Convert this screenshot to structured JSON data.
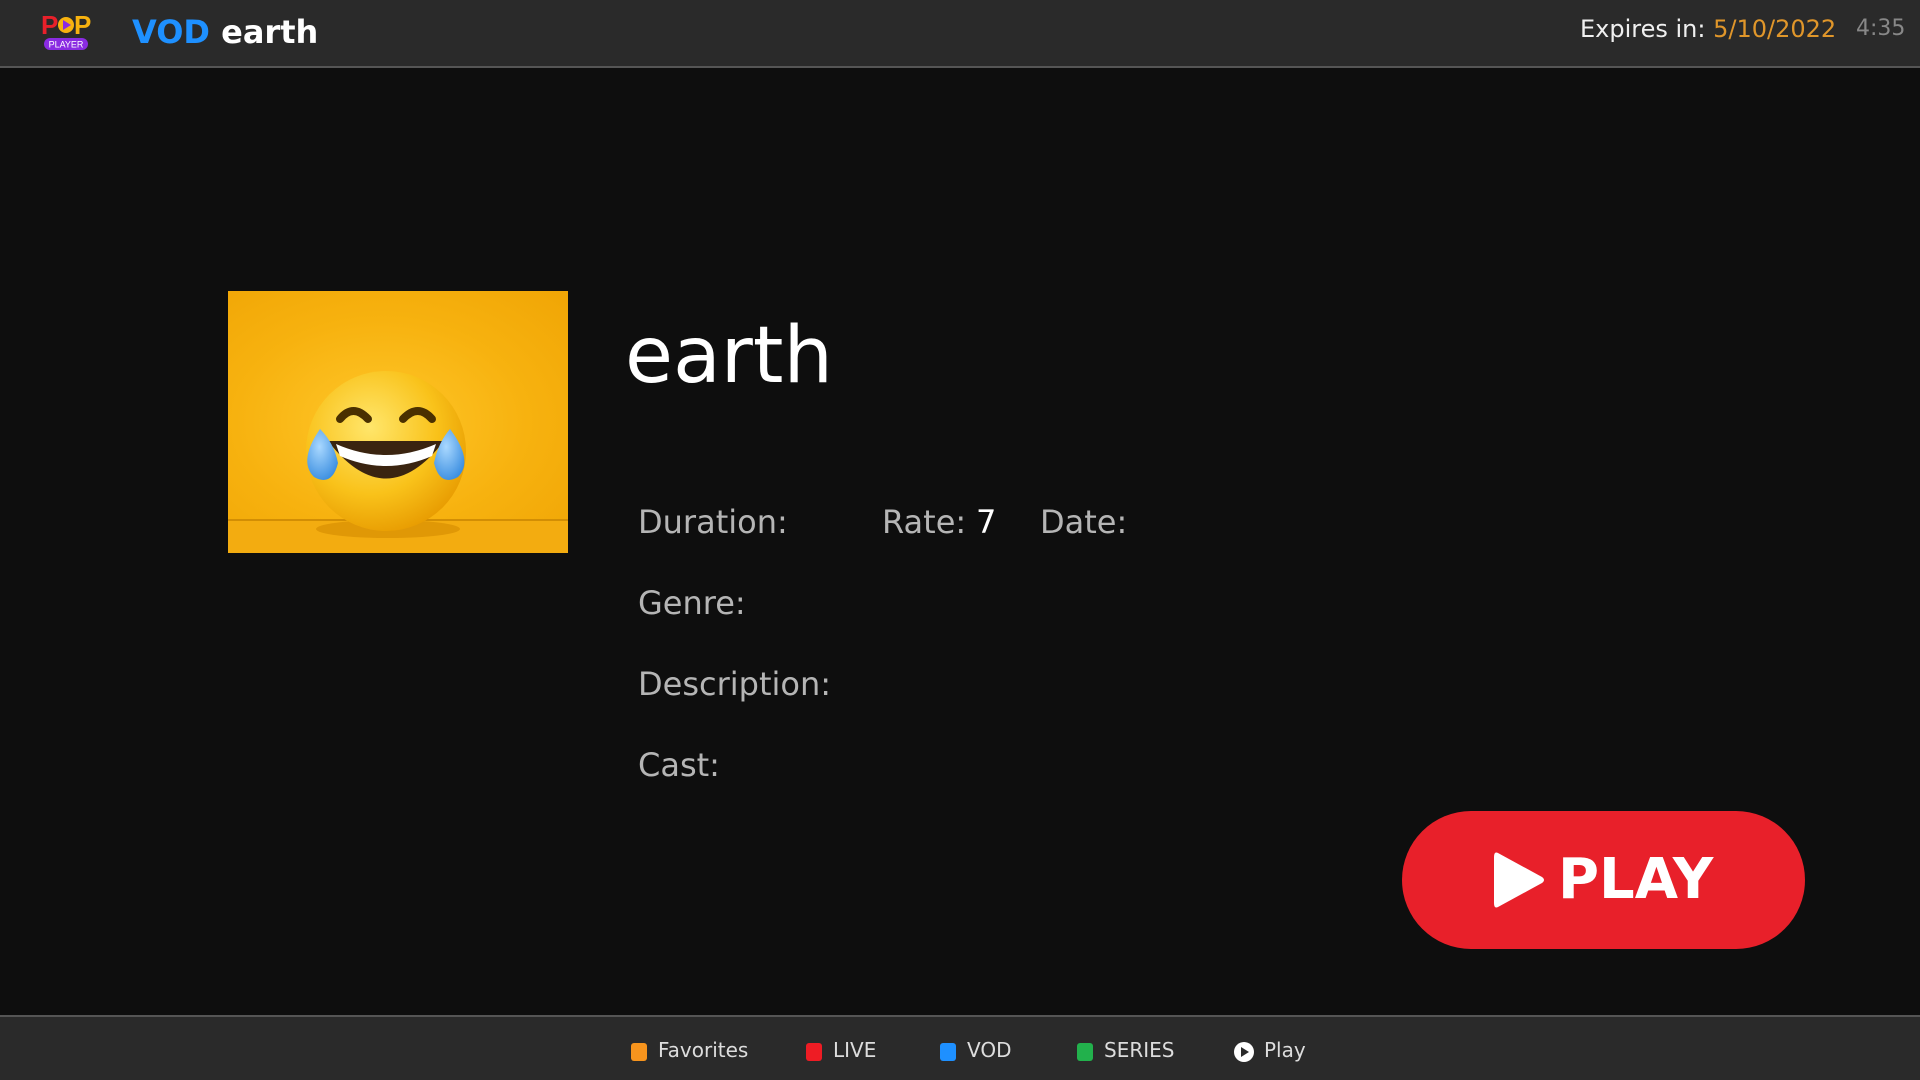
{
  "header": {
    "section": "VOD",
    "title": "earth",
    "expires_label": "Expires in:",
    "expires_date": "5/10/2022",
    "clock": "4:35",
    "logo_text": "PoP PLAYER"
  },
  "movie": {
    "title": "earth",
    "duration_label": "Duration:",
    "rate_label": "Rate:",
    "rate_value": "7",
    "date_label": "Date:",
    "genre_label": "Genre:",
    "description_label": "Description:",
    "cast_label": "Cast:"
  },
  "play_button": {
    "label": "PLAY"
  },
  "footer": {
    "items": [
      {
        "label": "Favorites",
        "color": "#f7941d"
      },
      {
        "label": "LIVE",
        "color": "#ee1c24"
      },
      {
        "label": "VOD",
        "color": "#1e90ff"
      },
      {
        "label": "SERIES",
        "color": "#22b14c"
      },
      {
        "label": "Play",
        "icon": "play-circle-icon"
      }
    ]
  },
  "colors": {
    "accent_blue": "#1e90ff",
    "play_red": "#e8202a",
    "expires_orange": "#e0962a"
  }
}
